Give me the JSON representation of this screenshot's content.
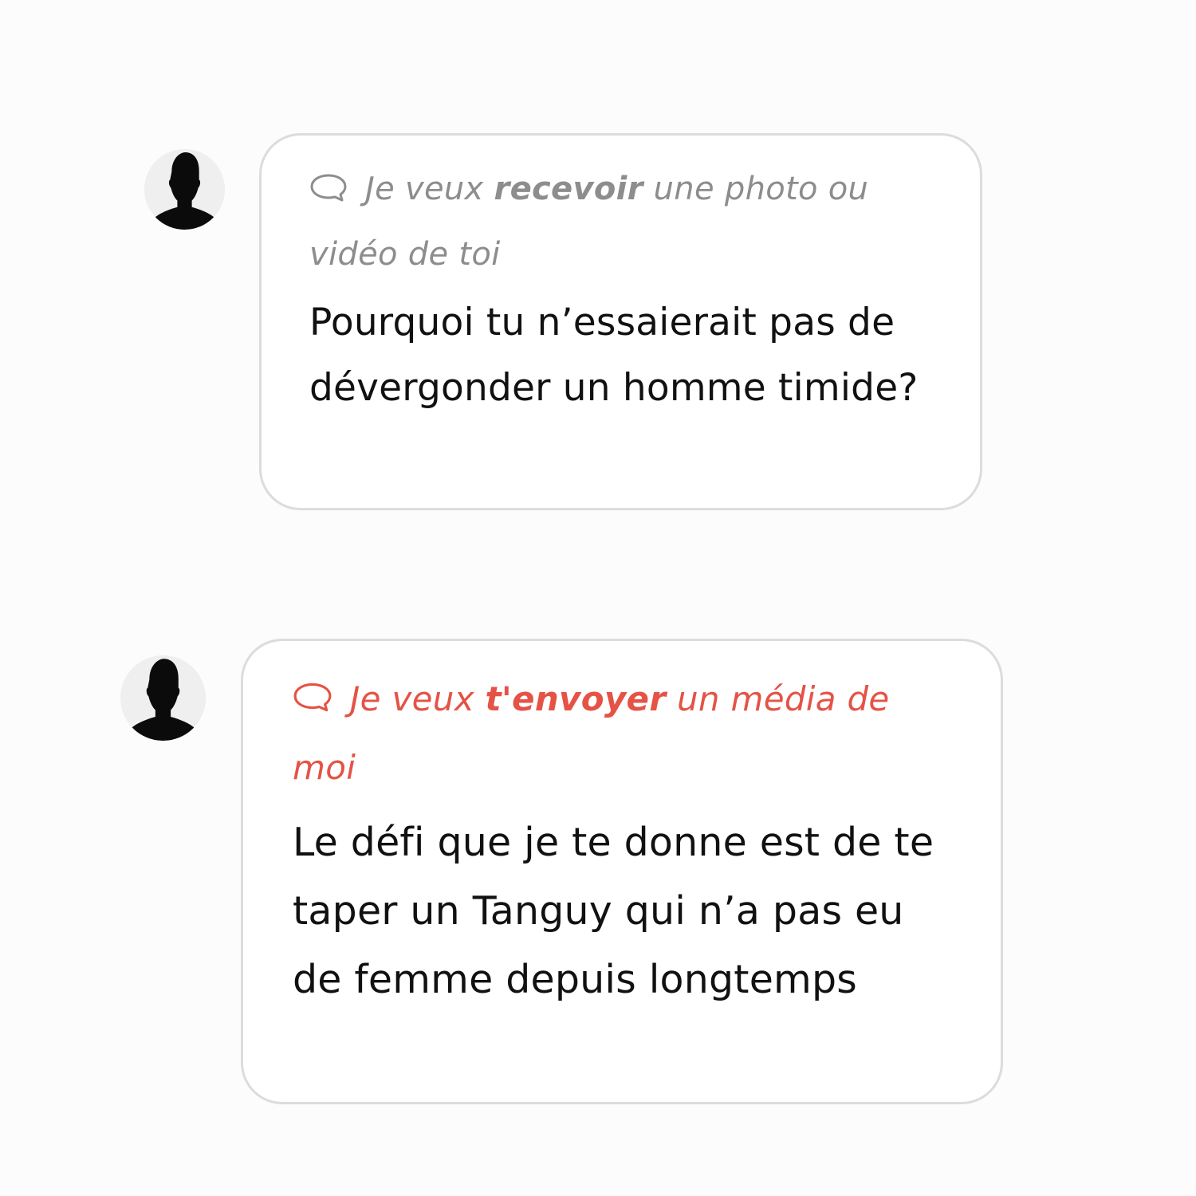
{
  "messages": [
    {
      "avatar_icon": "person-silhouette-icon",
      "tag": {
        "icon": "chat-bubble-icon",
        "prefix": "Je veux ",
        "emphasis": "recevoir",
        "suffix": " une photo ou vidéo de toi",
        "color": "#8d8d8d"
      },
      "text": "Pourquoi tu n’essaierait pas de dévergonder un homme timide?"
    },
    {
      "avatar_icon": "person-silhouette-icon",
      "tag": {
        "icon": "chat-bubble-icon",
        "prefix": "Je veux ",
        "emphasis": "t'envoyer",
        "suffix": " un média de moi",
        "color": "#e45346"
      },
      "text": "Le défi que je te donne est de te taper un Tanguy qui n’a pas eu de femme depuis longtemps"
    }
  ]
}
